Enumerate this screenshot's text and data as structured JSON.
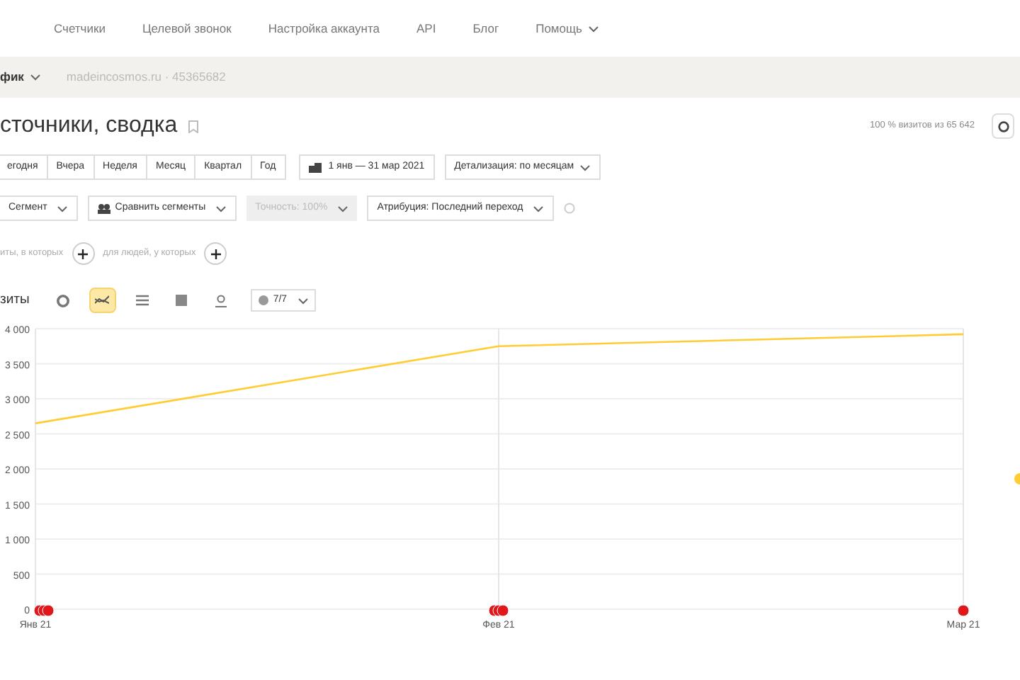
{
  "nav": {
    "items": [
      {
        "label": "Счетчики",
        "dropdown": false
      },
      {
        "label": "Целевой звонок",
        "dropdown": false
      },
      {
        "label": "Настройка аккаунта",
        "dropdown": false
      },
      {
        "label": "API",
        "dropdown": false
      },
      {
        "label": "Блог",
        "dropdown": false
      },
      {
        "label": "Помощь",
        "dropdown": true
      }
    ]
  },
  "counter_bar": {
    "report_menu": "фик",
    "counter": "madeincosmos.ru · 45365682"
  },
  "report": {
    "title": "сточники, сводка",
    "sample_info": "100 % визитов из 65 642"
  },
  "periods": [
    {
      "label": "егодня",
      "selected": false
    },
    {
      "label": "Вчера",
      "selected": false
    },
    {
      "label": "Неделя",
      "selected": false
    },
    {
      "label": "Месяц",
      "selected": false
    },
    {
      "label": "Квартал",
      "selected": false
    },
    {
      "label": "Год",
      "selected": false
    }
  ],
  "date_range": "1 янв — 31 мар 2021",
  "detail": "Детализация: по месяцам",
  "filters": [
    {
      "label": "Сегмент",
      "disabled": false,
      "kind": "plain"
    },
    {
      "label": "Сравнить сегменты",
      "disabled": false,
      "kind": "compare"
    },
    {
      "label": "Точность: 100%",
      "disabled": true,
      "kind": "plain"
    },
    {
      "label": "Атрибуция: Последний переход",
      "disabled": false,
      "kind": "plain"
    }
  ],
  "conditions": [
    "иты, в которых",
    "для людей, у которых"
  ],
  "chart_toolbar": {
    "title": "зиты",
    "views": [
      {
        "kind": "pie",
        "selected": false
      },
      {
        "kind": "line",
        "selected": true
      },
      {
        "kind": "stacked",
        "selected": false
      },
      {
        "kind": "bars",
        "selected": false
      },
      {
        "kind": "map",
        "selected": false
      }
    ],
    "annotations": "7/7"
  },
  "chart": {
    "chart_data": {
      "type": "line",
      "categories": [
        "Янв 21",
        "Фев 21",
        "Мар 21"
      ],
      "ylim": [
        0,
        4000
      ],
      "yticks": [
        {
          "value": 0,
          "label": "0"
        },
        {
          "value": 500,
          "label": "500"
        },
        {
          "value": 1000,
          "label": "1 000"
        },
        {
          "value": 1500,
          "label": "1 500"
        },
        {
          "value": 2000,
          "label": "2 000"
        },
        {
          "value": 2500,
          "label": "2 500"
        },
        {
          "value": 3000,
          "label": "3 000"
        },
        {
          "value": 3500,
          "label": "3 500"
        },
        {
          "value": 4000,
          "label": "4 000"
        }
      ],
      "grid": true,
      "ref_lines": [
        {
          "axis": "x",
          "value": "Фев 21"
        }
      ],
      "series": [
        {
          "color": "#ffcc33",
          "values": [
            2650,
            3750,
            3920
          ]
        }
      ]
    },
    "markers": [
      {
        "kind": "stack"
      },
      {
        "kind": "stack"
      },
      {
        "kind": "single"
      }
    ]
  }
}
